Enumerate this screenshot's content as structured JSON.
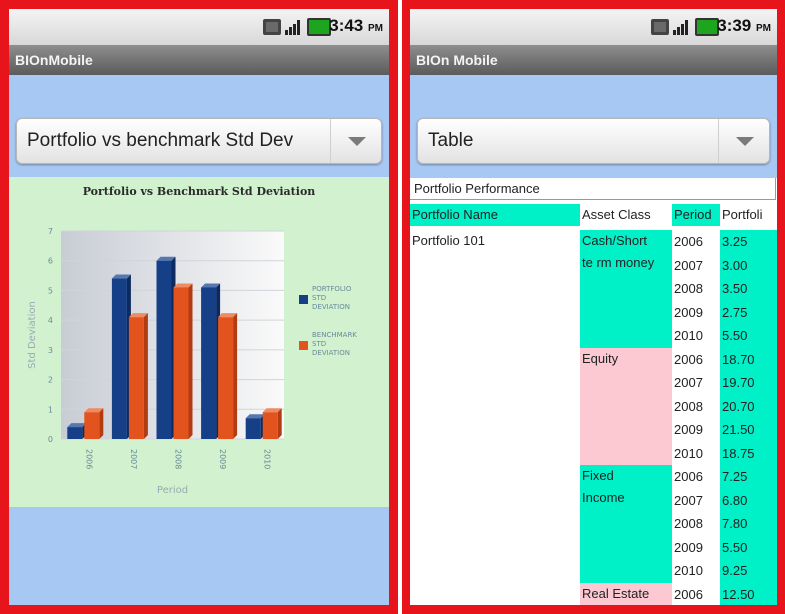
{
  "left": {
    "time": "3:43",
    "ampm": "PM",
    "app_title": "BIOnMobile",
    "spinner_value": "Portfolio vs benchmark Std Dev",
    "chart_data": {
      "type": "bar",
      "title": "Portfolio vs Benchmark Std Deviation",
      "xlabel": "Period",
      "ylabel": "Std Deviation",
      "categories": [
        "2006",
        "2007",
        "2008",
        "2009",
        "2010"
      ],
      "series": [
        {
          "name": "PORTFOLIO STD DEVIATION",
          "values": [
            0.4,
            5.4,
            6.0,
            5.1,
            0.7
          ],
          "color": "#153f86"
        },
        {
          "name": "BENCHMARK STD DEVIATION",
          "values": [
            0.9,
            4.1,
            5.1,
            4.1,
            0.9
          ],
          "color": "#e2531d"
        }
      ],
      "ylim": [
        0,
        7
      ],
      "yticks": [
        "0",
        "1",
        "2",
        "3",
        "4",
        "5",
        "6",
        "7"
      ],
      "grid": true,
      "legend_position": "right"
    }
  },
  "right": {
    "time": "3:39",
    "ampm": "PM",
    "app_title": "BIOn Mobile",
    "spinner_value": "Table",
    "table_title": "Portfolio Performance",
    "headers": [
      "Portfolio Name",
      "Asset Class",
      "Period",
      "Portfoli"
    ],
    "portfolio_name": "Portfolio 101",
    "groups": [
      {
        "asset_class": [
          "Cash/Short",
          "te rm money"
        ],
        "color": "#00f0c8",
        "rows": [
          [
            "2006",
            "3.25"
          ],
          [
            "2007",
            "3.00"
          ],
          [
            "2008",
            "3.50"
          ],
          [
            "2009",
            "2.75"
          ],
          [
            "2010",
            "5.50"
          ]
        ]
      },
      {
        "asset_class": [
          "Equity"
        ],
        "color": "#fcc9d2",
        "rows": [
          [
            "2006",
            "18.70"
          ],
          [
            "2007",
            "19.70"
          ],
          [
            "2008",
            "20.70"
          ],
          [
            "2009",
            "21.50"
          ],
          [
            "2010",
            "18.75"
          ]
        ]
      },
      {
        "asset_class": [
          "Fixed",
          "Income"
        ],
        "color": "#00f0c8",
        "rows": [
          [
            "2006",
            "7.25"
          ],
          [
            "2007",
            "6.80"
          ],
          [
            "2008",
            "7.80"
          ],
          [
            "2009",
            "5.50"
          ],
          [
            "2010",
            "9.25"
          ]
        ]
      },
      {
        "asset_class": [
          "Real Estate"
        ],
        "color": "#fcc9d2",
        "rows": [
          [
            "2006",
            "12.50"
          ]
        ]
      }
    ]
  }
}
